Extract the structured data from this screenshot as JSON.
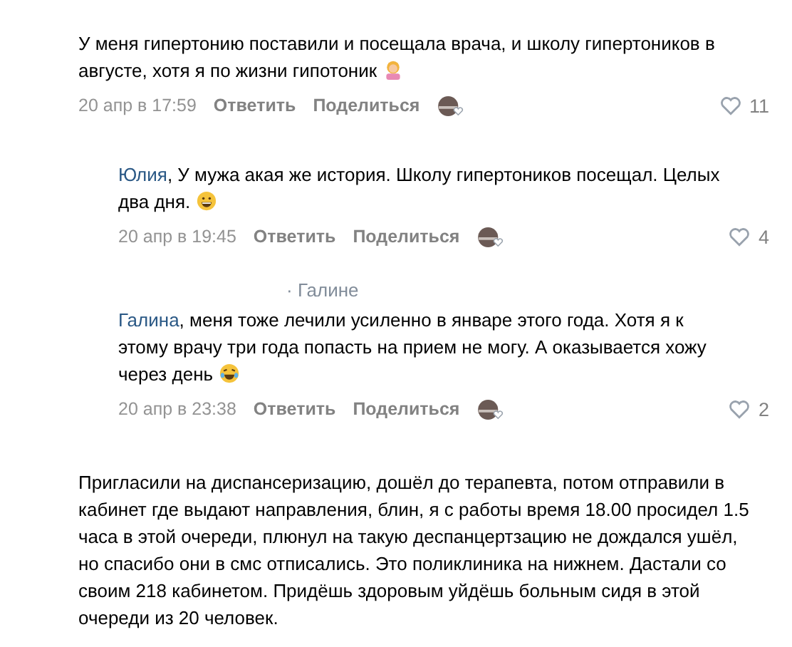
{
  "comments": [
    {
      "text": "У меня гипертонию поставили и посещала врача, и школу гипертоников в августе, хотя я по жизни гипотоник",
      "emoji": {
        "kind": "person"
      },
      "date": "20 апр в 17:59",
      "reply_button": "Ответить",
      "share_button": "Поделиться",
      "likes": "11",
      "replies": [
        {
          "author": "Юлия",
          "text": ", У мужа акая же история. Школу гипертоников посещал. Целых два дня.",
          "emoji": {
            "kind": "grin"
          },
          "date": "20 апр в 19:45",
          "reply_button": "Ответить",
          "share_button": "Поделиться",
          "likes": "4"
        },
        {
          "reply_to": "· Галине",
          "author": "Галина",
          "text": ", меня тоже лечили усиленно в январе этого года. Хотя я к этому врачу три года попасть на прием не могу. А оказывается хожу через день",
          "emoji": {
            "kind": "laugh"
          },
          "date": "20 апр в 23:38",
          "reply_button": "Ответить",
          "share_button": "Поделиться",
          "likes": "2"
        }
      ]
    },
    {
      "text": "Пригласили на диспансеризацию, дошёл до терапевта, потом отправили в кабинет где выдают направления, блин, я с работы время 18.00 просидел 1.5 часа в этой очереди, плюнул на такую деспанцертзацию не дождался ушёл, но спасибо они в смс отписались. Это поликлиника на нижнем. Дастали со своим 218 кабинетом. Придёшь здоровым уйдёшь больным сидя в этой очереди из 20 человек."
    }
  ]
}
